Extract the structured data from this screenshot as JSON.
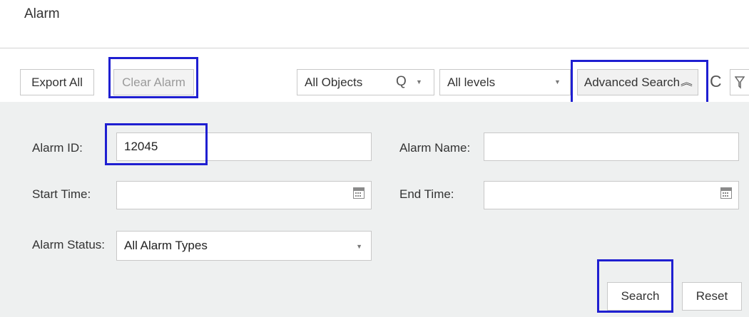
{
  "page": {
    "title": "Alarm"
  },
  "toolbar": {
    "export_all": "Export All",
    "clear_alarm": "Clear Alarm",
    "objects_select": "All Objects",
    "search_icon": "Q",
    "levels_select": "All levels",
    "advanced_search": "Advanced Search",
    "collapse_icon": "≈",
    "refresh_icon": "C",
    "filter_icon": "filter-icon"
  },
  "form": {
    "alarm_id_label": "Alarm ID:",
    "alarm_id_value": "12045",
    "alarm_name_label": "Alarm Name:",
    "alarm_name_value": "",
    "start_time_label": "Start Time:",
    "end_time_label": "End Time:",
    "alarm_status_label": "Alarm Status:",
    "alarm_status_value": "All Alarm Types"
  },
  "actions": {
    "search": "Search",
    "reset": "Reset"
  },
  "colors": {
    "highlight": "#1f1fd1",
    "panel_bg": "#eef0f0"
  }
}
